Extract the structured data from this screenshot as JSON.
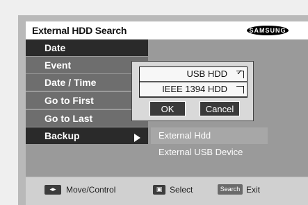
{
  "window": {
    "title": "External HDD Search",
    "brand": "SAMSUNG"
  },
  "menu": {
    "items": [
      {
        "label": "Date"
      },
      {
        "label": "Event"
      },
      {
        "label": "Date / Time"
      },
      {
        "label": "Go to First"
      },
      {
        "label": "Go to Last"
      },
      {
        "label": "Backup"
      }
    ]
  },
  "submenu": {
    "items": [
      {
        "label": "External Hdd",
        "selected": true
      },
      {
        "label": "External USB Device",
        "selected": false
      }
    ]
  },
  "dialog": {
    "options": [
      {
        "label": "USB HDD",
        "checked": true
      },
      {
        "label": "IEEE 1394 HDD",
        "checked": false
      }
    ],
    "ok_label": "OK",
    "cancel_label": "Cancel"
  },
  "footer": {
    "move_label": "Move/Control",
    "select_label": "Select",
    "search_key": "Search",
    "exit_label": "Exit"
  }
}
